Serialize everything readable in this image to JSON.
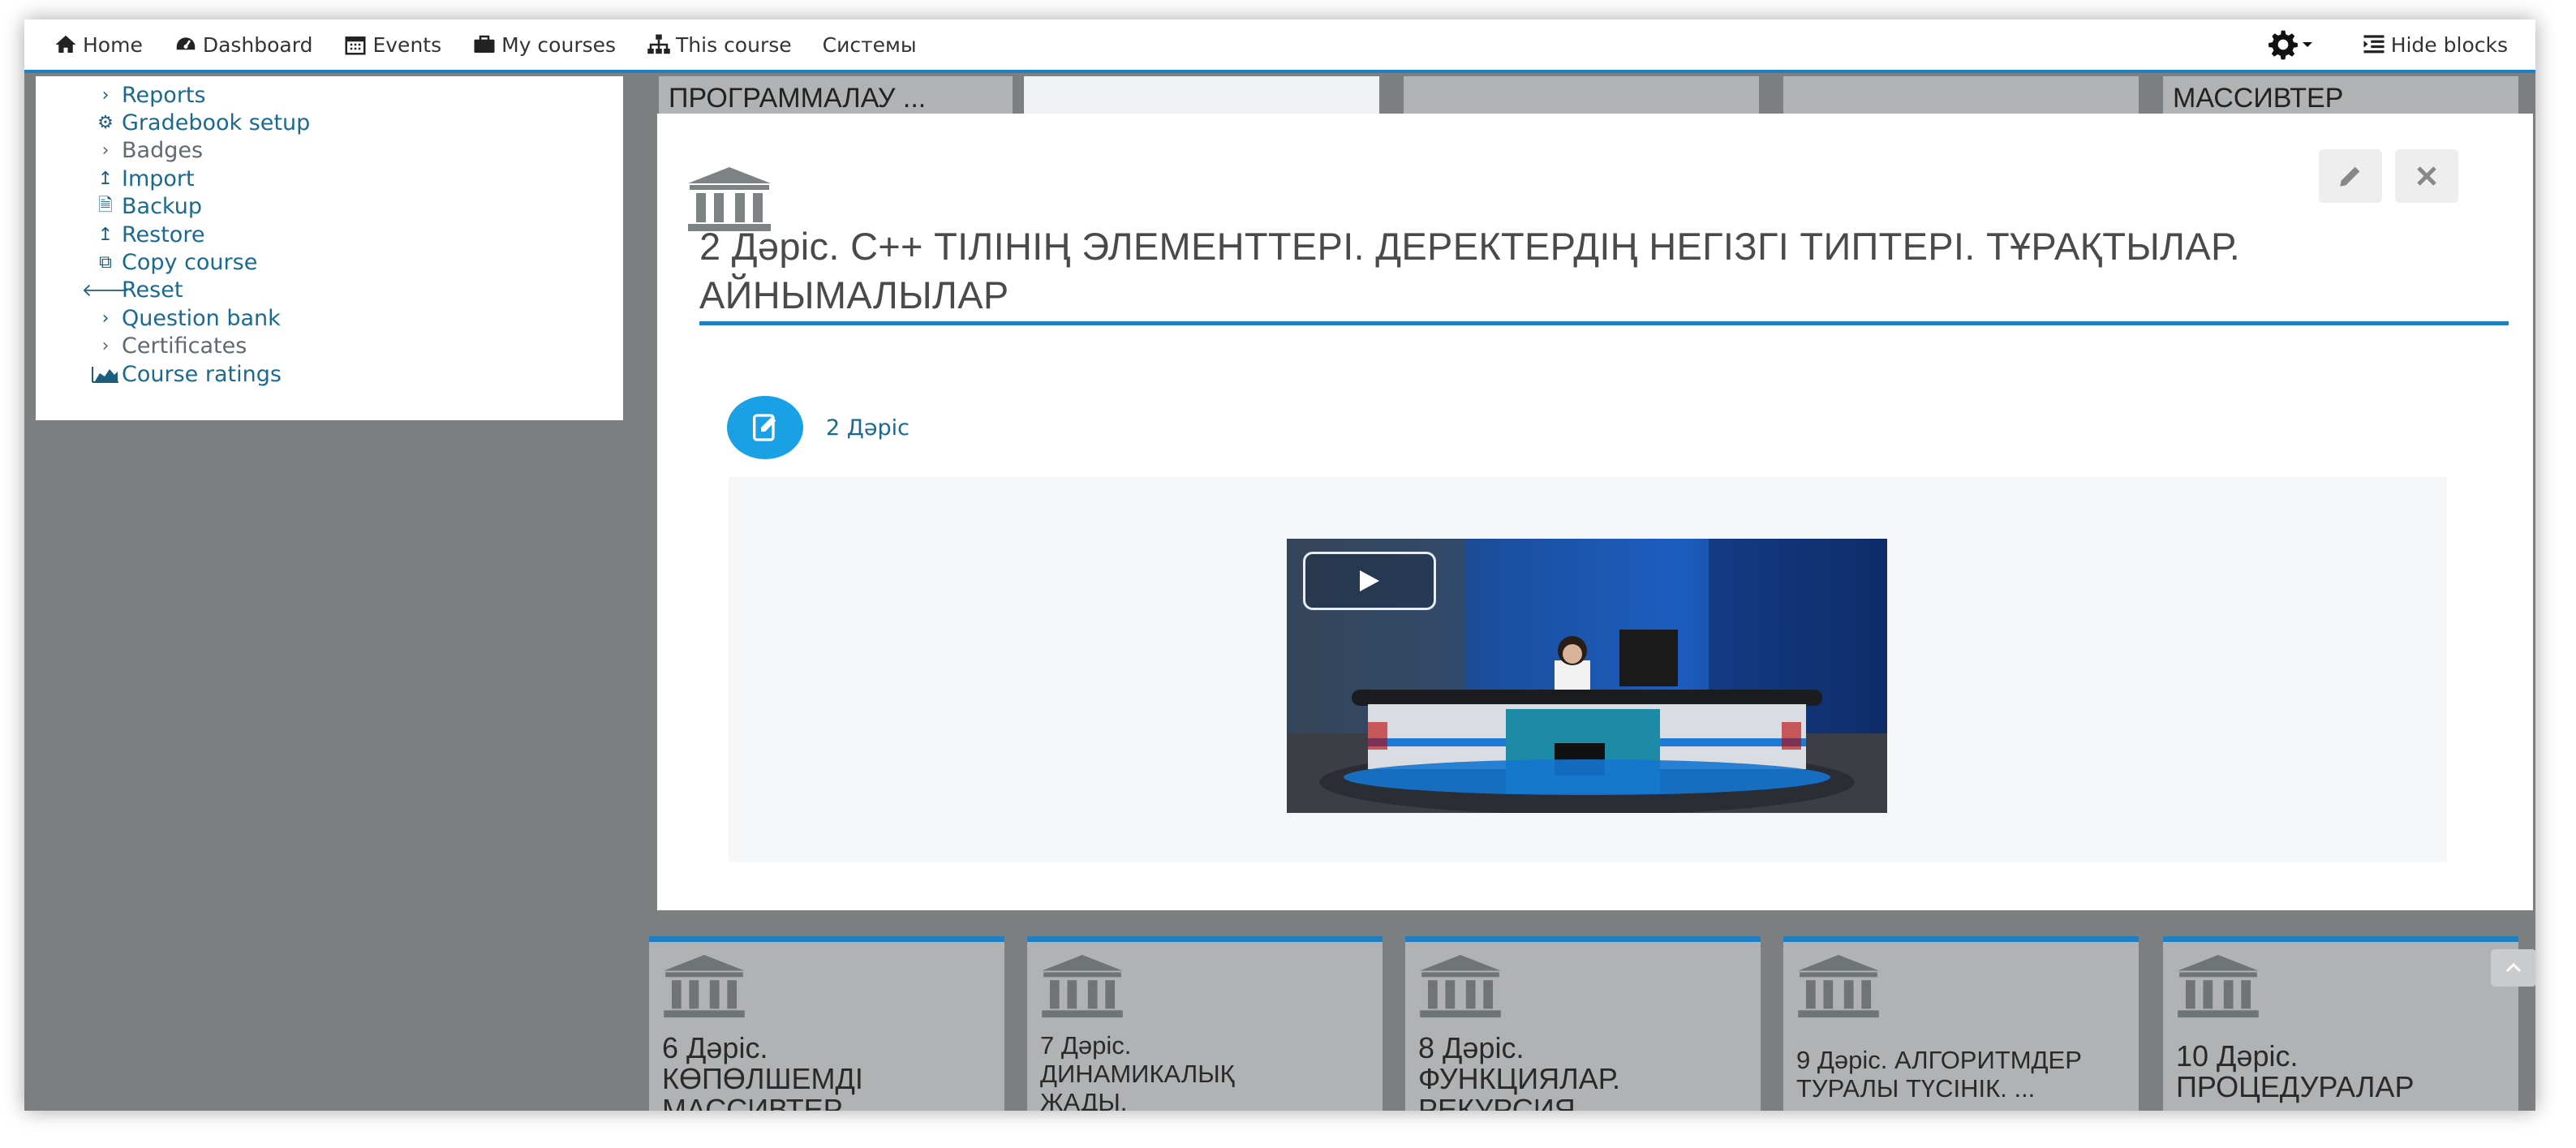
{
  "nav": {
    "home": "Home",
    "dashboard": "Dashboard",
    "events": "Events",
    "my_courses": "My courses",
    "this_course": "This course",
    "systems": "Системы",
    "hide_blocks": "Hide blocks"
  },
  "sidebar": {
    "items": [
      {
        "label": "Reports",
        "icon": "chevron-right-icon"
      },
      {
        "label": "Gradebook setup",
        "icon": "gear-icon"
      },
      {
        "label": "Badges",
        "icon": "chevron-right-icon"
      },
      {
        "label": "Import",
        "icon": "upload-arrow-icon"
      },
      {
        "label": "Backup",
        "icon": "file-archive-icon"
      },
      {
        "label": "Restore",
        "icon": "upload-arrow-icon"
      },
      {
        "label": "Copy course",
        "icon": "copy-icon"
      },
      {
        "label": "Reset",
        "icon": "arrow-left-icon"
      },
      {
        "label": "Question bank",
        "icon": "chevron-right-icon"
      },
      {
        "label": "Certificates",
        "icon": "chevron-right-icon"
      },
      {
        "label": "Course ratings",
        "icon": "area-chart-icon"
      }
    ]
  },
  "top_tiles": [
    {
      "text": "ПРОГРАММАЛАУ ..."
    },
    {
      "text": ""
    },
    {
      "text": ""
    },
    {
      "text": ""
    },
    {
      "text": "МАССИВТЕР"
    }
  ],
  "section": {
    "title": "2 Дәріс. С++ ТІЛІНІҢ ЭЛЕМЕНТТЕРІ. ДЕРЕКТЕРДІҢ НЕГІЗГІ ТИПТЕРІ. ТҰРАҚТЫЛАР. АЙНЫМАЛЫЛАР",
    "activity_label": "2 Дәріс"
  },
  "bottom_tiles": [
    {
      "line1": "6 Дәріс.",
      "line2": "КӨПӨЛШЕМДІ",
      "line3": "МАССИВТЕР"
    },
    {
      "line1": "7 Дәріс.",
      "line2": "ДИНАМИКАЛЫҚ",
      "line3": "ЖАДЫ."
    },
    {
      "line1": "8 Дәріс.",
      "line2": "ФУНКЦИЯЛАР.",
      "line3": "РЕКУРСИЯ"
    },
    {
      "line1": "9 Дәріс. АЛГОРИТМДЕР",
      "line2": "ТУРАЛЫ ТҮСІНІК. ...",
      "line3": ""
    },
    {
      "line1": "10 Дәріс.",
      "line2": "ПРОЦЕДУРАЛАР",
      "line3": ""
    }
  ],
  "colors": {
    "accent": "#1f7fc2",
    "link": "#1a6a8f",
    "tile_bg": "#b0b2b3",
    "page_bg": "#7c8080"
  }
}
